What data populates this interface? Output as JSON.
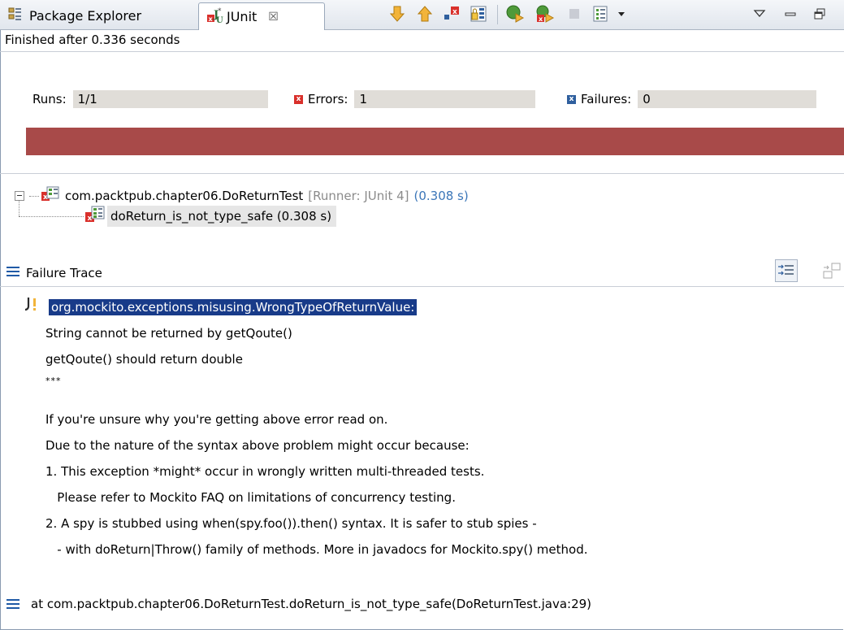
{
  "tabs": {
    "package_explorer": "Package Explorer",
    "junit": "JUnit",
    "close_glyph": "☒"
  },
  "toolbar_icons": [
    "next-failure-icon",
    "previous-failure-icon",
    "show-failures-only-icon",
    "scroll-lock-icon",
    "rerun-test-icon",
    "rerun-failed-first-icon",
    "stop-icon",
    "test-history-icon",
    "history-dropdown-icon",
    "view-menu-icon",
    "minimize-icon",
    "maximize-icon"
  ],
  "status": "Finished after 0.336 seconds",
  "counters": {
    "runs_label": "Runs:",
    "runs_value": "1/1",
    "errors_label": "Errors:",
    "errors_value": "1",
    "failures_label": "Failures:",
    "failures_value": "0"
  },
  "progress": {
    "fraction": 1.0,
    "color": "#a84a49",
    "state": "failed"
  },
  "tree": {
    "suite_name": "com.packtpub.chapter06.DoReturnTest",
    "suite_runner": "[Runner: JUnit 4]",
    "suite_time": "(0.308 s)",
    "test_name": "doReturn_is_not_type_safe (0.308 s)"
  },
  "trace": {
    "title": "Failure Trace",
    "lines": [
      "org.mockito.exceptions.misusing.WrongTypeOfReturnValue:",
      "String cannot be returned by getQoute()",
      "getQoute() should return double",
      "***",
      "If you're unsure why you're getting above error read on.",
      "Due to the nature of the syntax above problem might occur because:",
      "1. This exception *might* occur in wrongly written multi-threaded tests.",
      "   Please refer to Mockito FAQ on limitations of concurrency testing.",
      "2. A spy is stubbed using when(spy.foo()).then() syntax. It is safer to stub spies -",
      "   - with doReturn|Throw() family of methods. More in javadocs for Mockito.spy() method."
    ],
    "stack_frame": "at com.packtpub.chapter06.DoReturnTest.doReturn_is_not_type_safe(DoReturnTest.java:29)"
  },
  "colors": {
    "error_red": "#d9302b",
    "failure_blue": "#2f5f9e",
    "progress_fail": "#a84a49",
    "selection": "#183b89"
  }
}
